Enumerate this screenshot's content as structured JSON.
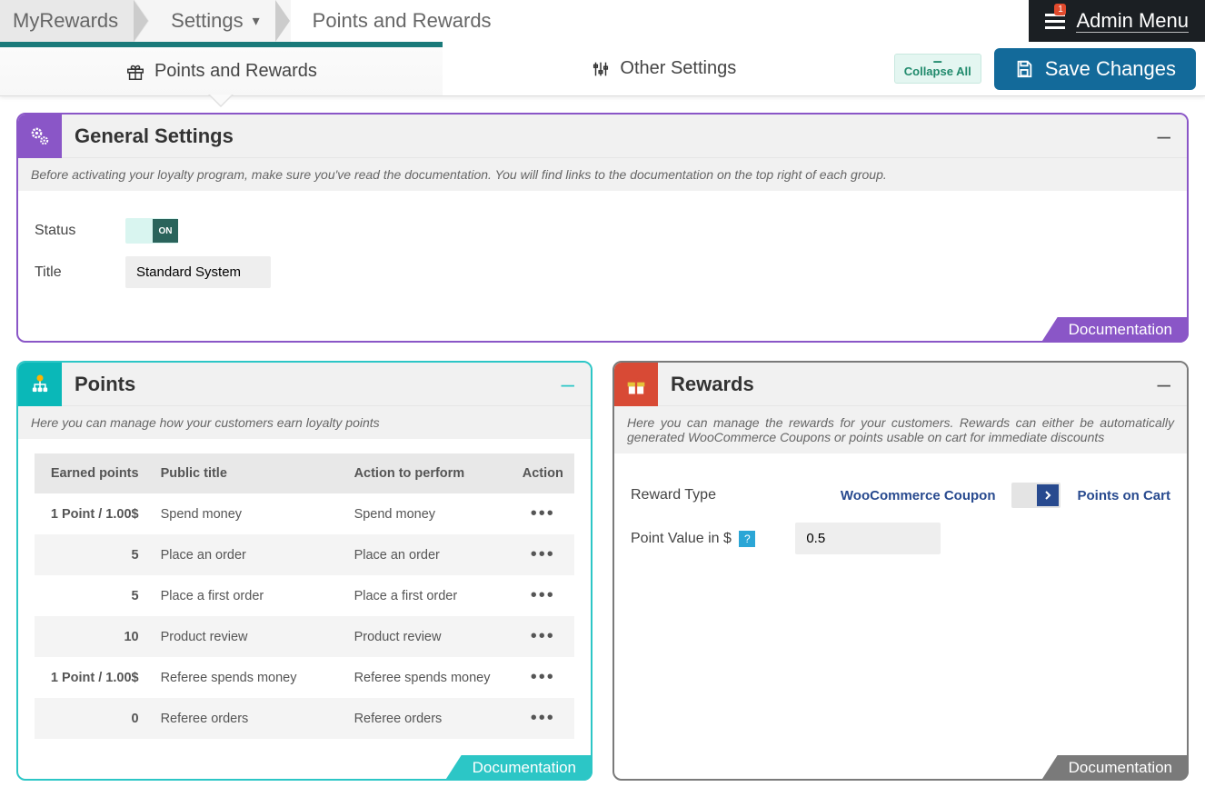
{
  "breadcrumb": {
    "app": "MyRewards",
    "section": "Settings",
    "page": "Points and Rewards"
  },
  "admin": {
    "menu_label": "Admin Menu",
    "notifications": "1"
  },
  "tabs": {
    "points_rewards": "Points and Rewards",
    "other_settings": "Other Settings"
  },
  "actions": {
    "collapse": "Collapse All",
    "save": "Save Changes"
  },
  "general": {
    "title": "General Settings",
    "desc": "Before activating your loyalty program, make sure you've read the documentation. You will find links to the documentation on the top right of each group.",
    "status_label": "Status",
    "status_on": "ON",
    "title_label": "Title",
    "title_value": "Standard System"
  },
  "points": {
    "title": "Points",
    "desc": "Here you can manage how your customers earn loyalty points",
    "cols": [
      "Earned points",
      "Public title",
      "Action to perform",
      "Action"
    ],
    "rows": [
      {
        "earned": "1 Point / 1.00$",
        "public": "Spend money",
        "action": "Spend money"
      },
      {
        "earned": "5",
        "public": "Place an order",
        "action": "Place an order"
      },
      {
        "earned": "5",
        "public": "Place a first order",
        "action": "Place a first order"
      },
      {
        "earned": "10",
        "public": "Product review",
        "action": "Product review"
      },
      {
        "earned": "1 Point / 1.00$",
        "public": "Referee spends money",
        "action": "Referee spends money"
      },
      {
        "earned": "0",
        "public": "Referee orders",
        "action": "Referee orders"
      }
    ]
  },
  "rewards": {
    "title": "Rewards",
    "desc": "Here you can manage the rewards for your customers. Rewards can either be automatically generated WooCommerce Coupons or points usable on cart for immediate discounts",
    "reward_type_label": "Reward Type",
    "reward_type_opt_a": "WooCommerce Coupon",
    "reward_type_opt_b": "Points on Cart",
    "point_value_label": "Point Value in $",
    "point_value": "0.5"
  },
  "doc_label": "Documentation"
}
